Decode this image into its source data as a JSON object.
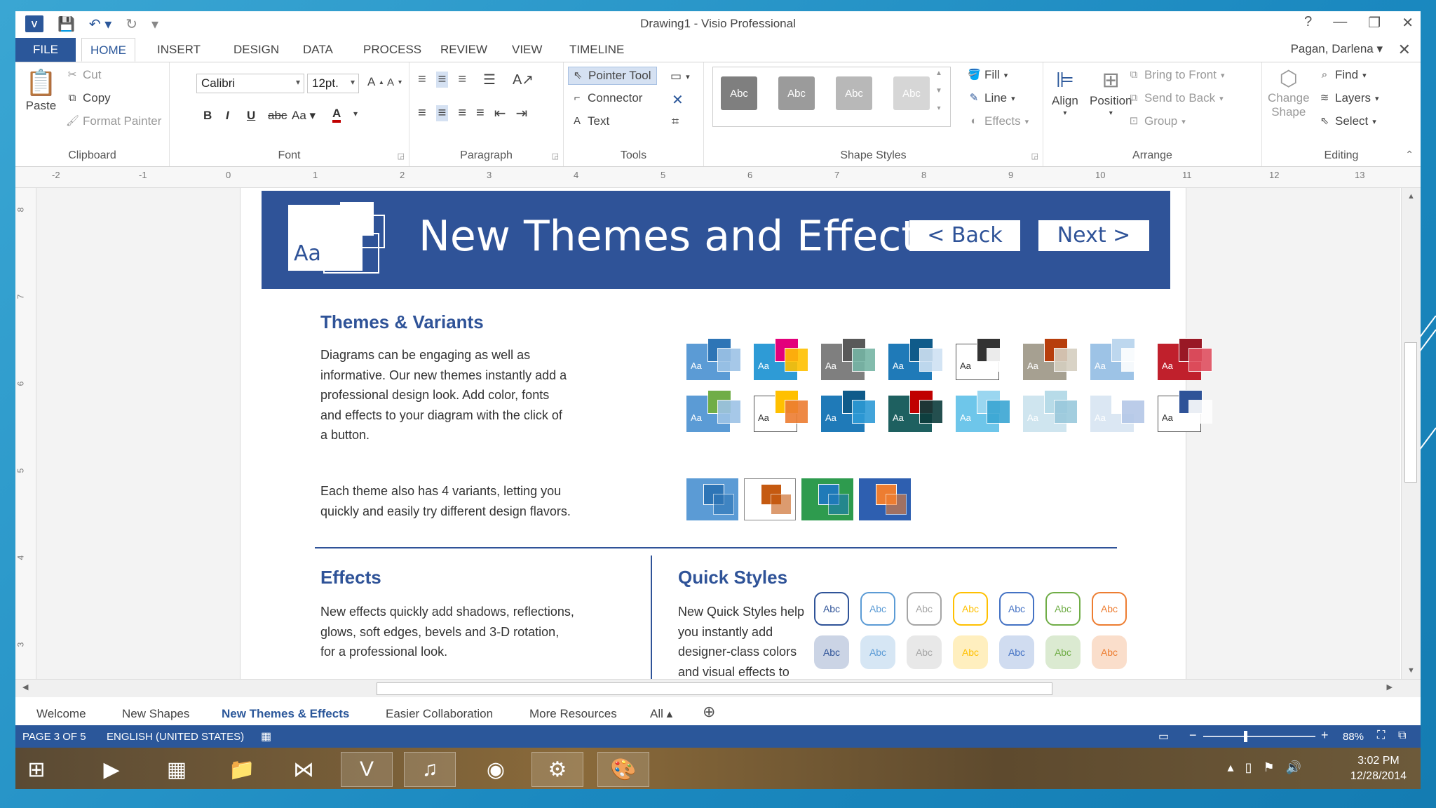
{
  "window": {
    "title": "Drawing1 - Visio Professional",
    "help": "?",
    "user": "Pagan, Darlena"
  },
  "menu": {
    "tabs": [
      "FILE",
      "HOME",
      "INSERT",
      "DESIGN",
      "DATA",
      "PROCESS",
      "REVIEW",
      "VIEW",
      "TIMELINE"
    ],
    "active": "HOME"
  },
  "ribbon": {
    "clipboard": {
      "paste": "Paste",
      "cut": "Cut",
      "copy": "Copy",
      "format_painter": "Format Painter",
      "label": "Clipboard"
    },
    "font": {
      "name": "Calibri",
      "size": "12pt.",
      "label": "Font",
      "bold": "B",
      "italic": "I",
      "underline": "U",
      "strike": "abc",
      "case": "Aa",
      "color": "A"
    },
    "paragraph": {
      "label": "Paragraph"
    },
    "tools": {
      "pointer": "Pointer Tool",
      "connector": "Connector",
      "text": "Text",
      "label": "Tools"
    },
    "shape_styles": {
      "label": "Shape Styles",
      "fill": "Fill",
      "line": "Line",
      "effects": "Effects",
      "sample": "Abc"
    },
    "arrange": {
      "align": "Align",
      "position": "Position",
      "bring_front": "Bring to Front",
      "send_back": "Send to Back",
      "group": "Group",
      "label": "Arrange"
    },
    "editing": {
      "change_shape_1": "Change",
      "change_shape_2": "Shape",
      "find": "Find",
      "layers": "Layers",
      "select": "Select",
      "label": "Editing"
    }
  },
  "ruler": {
    "ticks": [
      "-2",
      "-1",
      "0",
      "1",
      "2",
      "3",
      "4",
      "5",
      "6",
      "7",
      "8",
      "9",
      "10",
      "11",
      "12",
      "13"
    ],
    "vticks": [
      "8",
      "7",
      "6",
      "5",
      "4",
      "3"
    ]
  },
  "page": {
    "banner_title": "New Themes and Effects",
    "back": "< Back",
    "next": "Next >",
    "logo_text": "Aa",
    "themes_heading": "Themes & Variants",
    "themes_text": [
      "Diagrams can be engaging as well as",
      "informative. Our new themes instantly add a",
      "professional design look. Add color, fonts",
      "and effects to your diagram with the click of",
      "a button."
    ],
    "variants_text": [
      "Each theme also has 4 variants, letting you",
      "quickly and easily try different design flavors."
    ],
    "effects_heading": "Effects",
    "effects_text": [
      "New effects quickly add shadows, reflections,",
      "glows, soft edges, bevels and 3-D rotation,",
      "for a professional look."
    ],
    "quick_heading": "Quick Styles",
    "quick_text": [
      "New Quick Styles help",
      "you instantly add",
      "designer-class colors",
      "and visual effects to"
    ],
    "thumb_text": "Aa",
    "qs_text": "Abc",
    "qs_colors": [
      "#2f5398",
      "#5b9bd5",
      "#a5a5a5",
      "#ffc000",
      "#4472c4",
      "#70ad47",
      "#ed7d31"
    ]
  },
  "page_tabs": [
    "Welcome",
    "New Shapes",
    "New Themes & Effects",
    "Easier Collaboration",
    "More Resources",
    "All ▴"
  ],
  "active_page_tab": "New Themes & Effects",
  "status": {
    "page": "PAGE 3 OF 5",
    "language": "ENGLISH (UNITED STATES)",
    "zoom": "88%"
  },
  "taskbar": {
    "time": "3:02 PM",
    "date": "12/28/2014"
  }
}
